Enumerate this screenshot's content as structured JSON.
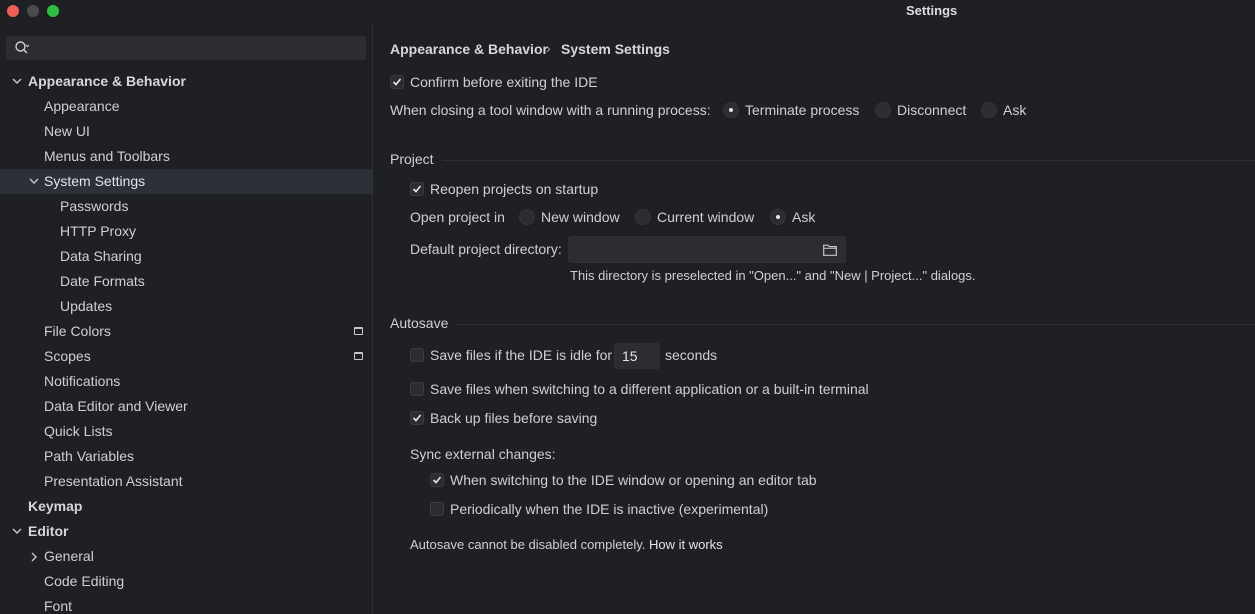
{
  "window": {
    "title": "Settings"
  },
  "search": {
    "placeholder": ""
  },
  "sidebar": {
    "items": [
      {
        "label": "Appearance & Behavior"
      },
      {
        "label": "Appearance"
      },
      {
        "label": "New UI"
      },
      {
        "label": "Menus and Toolbars"
      },
      {
        "label": "System Settings"
      },
      {
        "label": "Passwords"
      },
      {
        "label": "HTTP Proxy"
      },
      {
        "label": "Data Sharing"
      },
      {
        "label": "Date Formats"
      },
      {
        "label": "Updates"
      },
      {
        "label": "File Colors"
      },
      {
        "label": "Scopes"
      },
      {
        "label": "Notifications"
      },
      {
        "label": "Data Editor and Viewer"
      },
      {
        "label": "Quick Lists"
      },
      {
        "label": "Path Variables"
      },
      {
        "label": "Presentation Assistant"
      },
      {
        "label": "Keymap"
      },
      {
        "label": "Editor"
      },
      {
        "label": "General"
      },
      {
        "label": "Code Editing"
      },
      {
        "label": "Font"
      }
    ]
  },
  "breadcrumb": {
    "parent": "Appearance & Behavior",
    "separator": "›",
    "current": "System Settings"
  },
  "general": {
    "confirm_exit": {
      "label": "Confirm before exiting the IDE",
      "checked": true
    },
    "closing_label": "When closing a tool window with a running process:",
    "closing_options": [
      {
        "label": "Terminate process",
        "selected": true
      },
      {
        "label": "Disconnect",
        "selected": false
      },
      {
        "label": "Ask",
        "selected": false
      }
    ]
  },
  "project": {
    "title": "Project",
    "reopen": {
      "label": "Reopen projects on startup",
      "checked": true
    },
    "open_in_label": "Open project in",
    "open_in_options": [
      {
        "label": "New window",
        "selected": false
      },
      {
        "label": "Current window",
        "selected": false
      },
      {
        "label": "Ask",
        "selected": true
      }
    ],
    "default_dir_label": "Default project directory:",
    "default_dir_value": "",
    "default_dir_hint": "This directory is preselected in \"Open...\" and \"New | Project...\" dialogs."
  },
  "autosave": {
    "title": "Autosave",
    "idle": {
      "label": "Save files if the IDE is idle for",
      "checked": false,
      "value": "15",
      "unit": "seconds"
    },
    "switching": {
      "label": "Save files when switching to a different application or a built-in terminal",
      "checked": false
    },
    "backup": {
      "label": "Back up files before saving",
      "checked": true
    },
    "sync_label": "Sync external changes:",
    "sync_switch": {
      "label": "When switching to the IDE window or opening an editor tab",
      "checked": true
    },
    "sync_periodic": {
      "label": "Periodically when the IDE is inactive (experimental)",
      "checked": false
    },
    "note": "Autosave cannot be disabled completely.",
    "note_link": "How it works"
  },
  "colors": {
    "background": "#1f2024",
    "selection": "#2e3039",
    "field": "#2b2d31"
  }
}
